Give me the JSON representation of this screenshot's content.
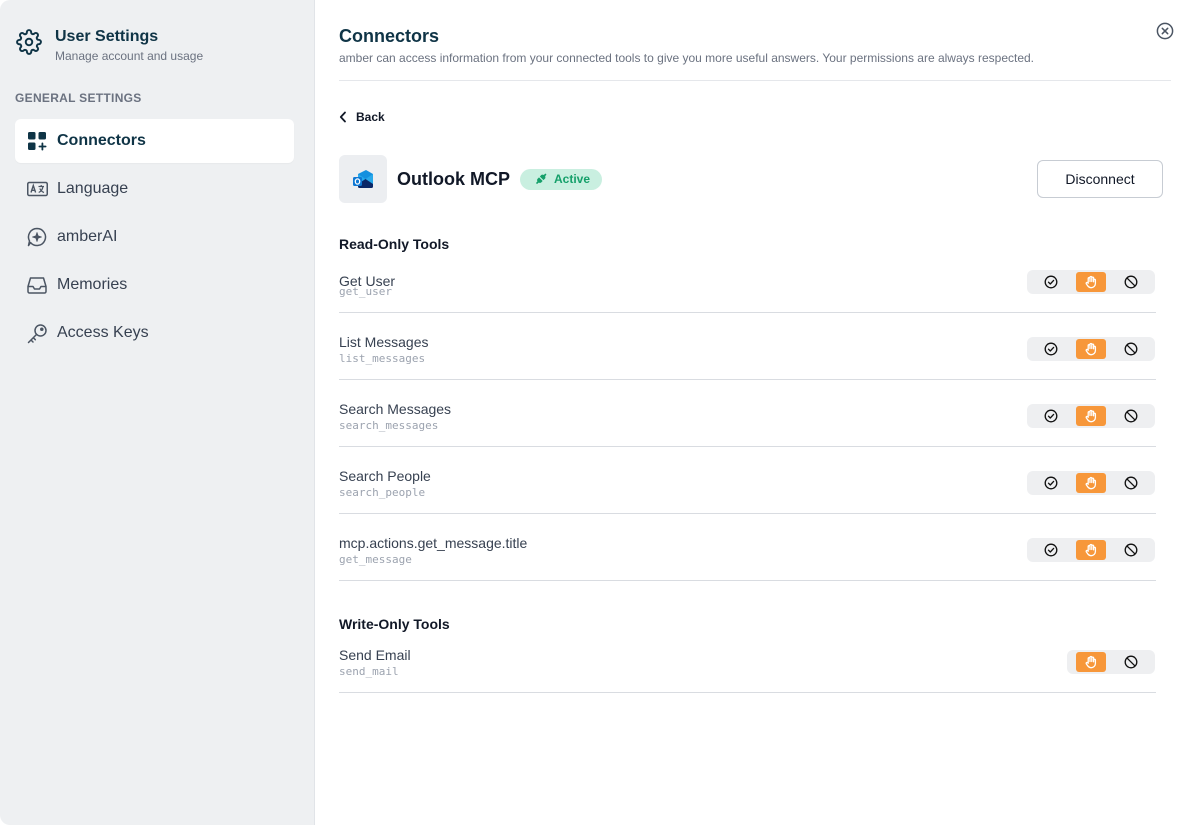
{
  "sidebar": {
    "title": "User Settings",
    "subtitle": "Manage account and usage",
    "section": "GENERAL SETTINGS",
    "items": [
      {
        "label": "Connectors",
        "icon": "grid-plus-icon",
        "active": true
      },
      {
        "label": "Language",
        "icon": "language-icon",
        "active": false
      },
      {
        "label": "amberAI",
        "icon": "ai-chat-icon",
        "active": false
      },
      {
        "label": "Memories",
        "icon": "inbox-icon",
        "active": false
      },
      {
        "label": "Access Keys",
        "icon": "key-icon",
        "active": false
      }
    ]
  },
  "main": {
    "title": "Connectors",
    "description": "amber can access information from your connected tools to give you more useful answers. Your permissions are always respected.",
    "back_label": "Back",
    "connector": {
      "name": "Outlook MCP",
      "status": "Active",
      "disconnect_label": "Disconnect"
    },
    "read_only_title": "Read-Only Tools",
    "read_only_tools": [
      {
        "name": "Get User",
        "id": "get_user",
        "selected": "ask"
      },
      {
        "name": "List Messages",
        "id": "list_messages",
        "selected": "ask"
      },
      {
        "name": "Search Messages",
        "id": "search_messages",
        "selected": "ask"
      },
      {
        "name": "Search People",
        "id": "search_people",
        "selected": "ask"
      },
      {
        "name": "mcp.actions.get_message.title",
        "id": "get_message",
        "selected": "ask"
      }
    ],
    "write_only_title": "Write-Only Tools",
    "write_only_tools": [
      {
        "name": "Send Email",
        "id": "send_mail",
        "selected": "ask"
      }
    ]
  },
  "colors": {
    "accent_orange": "#f7973a",
    "active_badge_bg": "#c9efe0",
    "active_badge_text": "#15a06a",
    "title_navy": "#0f3446",
    "sidebar_bg": "#eef0f2"
  }
}
